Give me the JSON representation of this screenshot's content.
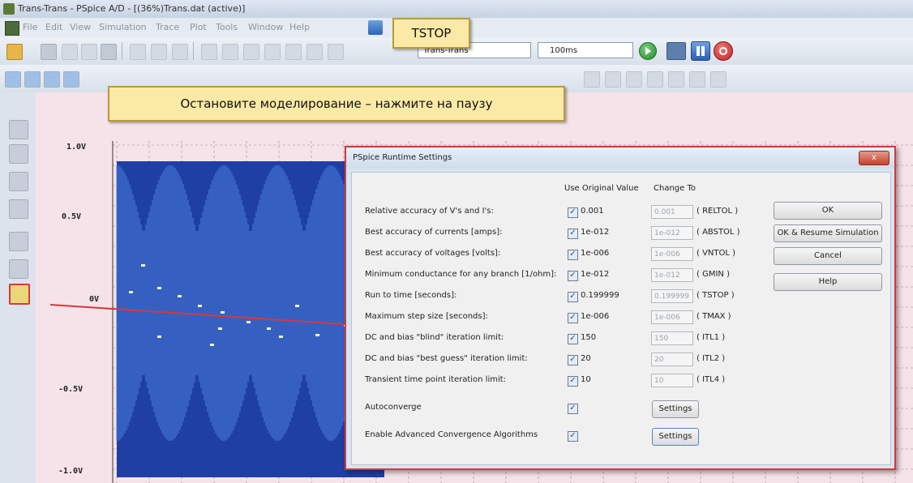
{
  "window": {
    "title": "Trans-Trans - PSpice A/D - [(36%)Trans.dat (active)]"
  },
  "menu": {
    "items": [
      "File",
      "Edit",
      "View",
      "Simulation",
      "Trace",
      "Plot",
      "Tools",
      "Window",
      "Help"
    ]
  },
  "toolbar": {
    "profile": "Trans-Trans",
    "tstop_value": "100ms"
  },
  "callouts": {
    "tstop": "TSTOP",
    "pause": "Остановите моделирование – нажмите на паузу"
  },
  "plot": {
    "y_ticks": [
      "1.0V",
      "0.5V",
      "0V",
      "-0.5V",
      "-1.0V"
    ]
  },
  "dialog": {
    "title": "PSpice Runtime Settings",
    "close": "x",
    "col_original": "Use Original Value",
    "col_change": "Change To",
    "rows": [
      {
        "label": "Relative accuracy of V's and I's:",
        "original": "0.001",
        "change": "0.001",
        "param": "( RELTOL )"
      },
      {
        "label": "Best accuracy of currents [amps]:",
        "original": "1e-012",
        "change": "1e-012",
        "param": "( ABSTOL )"
      },
      {
        "label": "Best accuracy of voltages [volts]:",
        "original": "1e-006",
        "change": "1e-006",
        "param": "( VNTOL )"
      },
      {
        "label": "Minimum conductance for any branch [1/ohm]:",
        "original": "1e-012",
        "change": "1e-012",
        "param": "( GMIN )"
      },
      {
        "label": "Run to time [seconds]:",
        "original": "0.199999",
        "change": "0.199999",
        "param": "( TSTOP )"
      },
      {
        "label": "Maximum step size [seconds]:",
        "original": "1e-006",
        "change": "1e-006",
        "param": "( TMAX )"
      },
      {
        "label": "DC and bias \"blind\" iteration limit:",
        "original": "150",
        "change": "150",
        "param": "( ITL1 )"
      },
      {
        "label": "DC and bias \"best guess\" iteration limit:",
        "original": "20",
        "change": "20",
        "param": "( ITL2 )"
      },
      {
        "label": "Transient time point iteration limit:",
        "original": "10",
        "change": "10",
        "param": "( ITL4 )"
      }
    ],
    "autoconverge": "Autoconverge",
    "advanced": "Enable Advanced Convergence Algorithms",
    "settings_label": "Settings",
    "buttons": {
      "ok": "OK",
      "ok_resume": "OK & Resume Simulation",
      "cancel": "Cancel",
      "help": "Help"
    }
  }
}
